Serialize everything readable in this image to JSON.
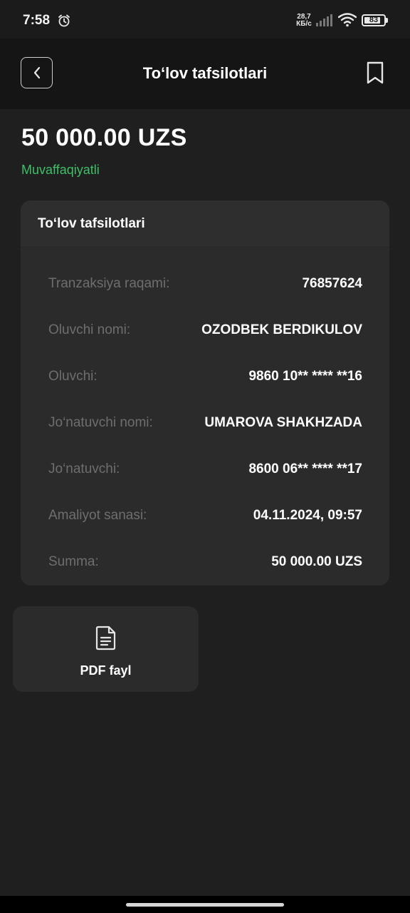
{
  "status_bar": {
    "time": "7:58",
    "net_speed_value": "28,7",
    "net_speed_unit": "КБ/с",
    "battery": "83",
    "battery_fraction": 0.83
  },
  "header": {
    "title": "To‘lov tafsilotlari",
    "back_icon": "chevron-left-icon",
    "bookmark_icon": "bookmark-icon"
  },
  "summary": {
    "amount": "50 000.00 UZS",
    "status": "Muvaffaqiyatli",
    "status_color": "#3fbf68"
  },
  "details": {
    "title": "To‘lov tafsilotlari",
    "rows": [
      {
        "label": "Tranzaksiya raqami:",
        "value": "76857624"
      },
      {
        "label": "Oluvchi nomi:",
        "value": "OZODBEK BERDIKULOV"
      },
      {
        "label": "Oluvchi:",
        "value": "9860 10** **** **16"
      },
      {
        "label": "Jo‘natuvchi nomi:",
        "value": "UMAROVA SHAKHZADA"
      },
      {
        "label": "Jo‘natuvchi:",
        "value": "8600 06** **** **17"
      },
      {
        "label": "Amaliyot sanasi:",
        "value": "04.11.2024, 09:57"
      },
      {
        "label": "Summa:",
        "value": "50 000.00 UZS"
      }
    ]
  },
  "pdf": {
    "label": "PDF fayl",
    "icon": "document-icon"
  }
}
